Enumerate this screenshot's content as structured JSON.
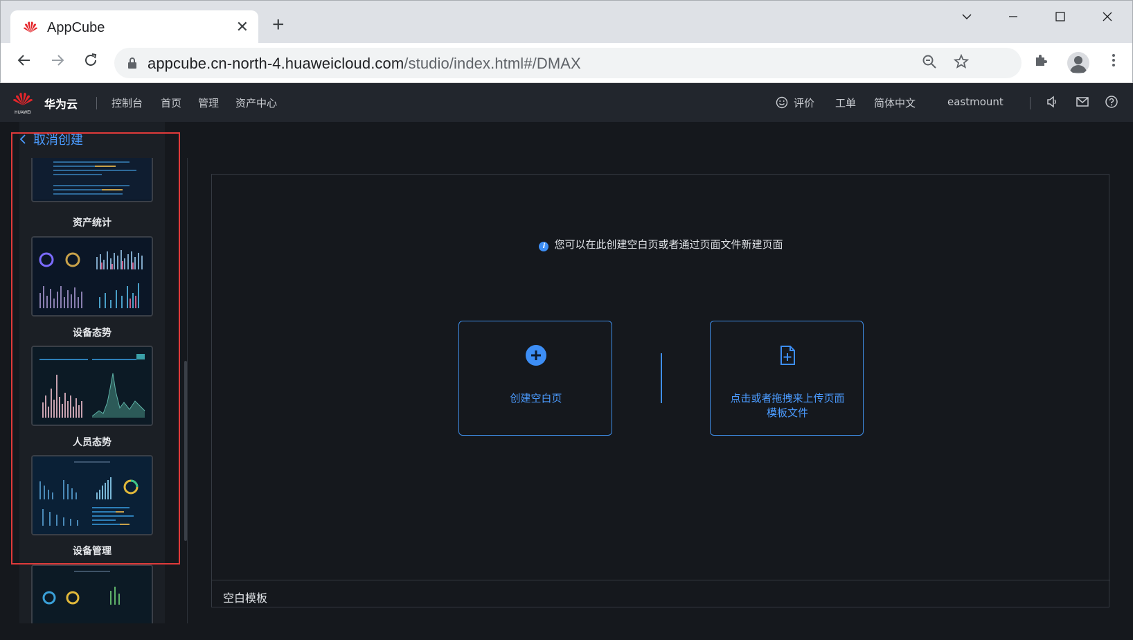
{
  "browser": {
    "tab_title": "AppCube",
    "url_host": "appcube.cn-north-4.huaweicloud.com",
    "url_path": "/studio/index.html#/DMAX"
  },
  "header": {
    "brand": "华为云",
    "logo_text": "HUAWEI",
    "nav": [
      "控制台",
      "首页",
      "管理",
      "资产中心"
    ],
    "rate": "评价",
    "ticket": "工单",
    "language": "简体中文",
    "user": "eastmount"
  },
  "sidebar": {
    "back_label": "取消创建",
    "templates": [
      {
        "label": "资产统计"
      },
      {
        "label": "设备态势"
      },
      {
        "label": "人员态势"
      },
      {
        "label": "设备管理"
      }
    ]
  },
  "main": {
    "info": "您可以在此创建空白页或者通过页面文件新建页面",
    "create_blank": "创建空白页",
    "upload_line1": "点击或者拖拽来上传页面",
    "upload_line2": "模板文件",
    "bottom_label": "空白模板"
  },
  "colors": {
    "accent": "#4b9bff",
    "highlight_border": "#e03a3a",
    "background": "#15181d"
  }
}
